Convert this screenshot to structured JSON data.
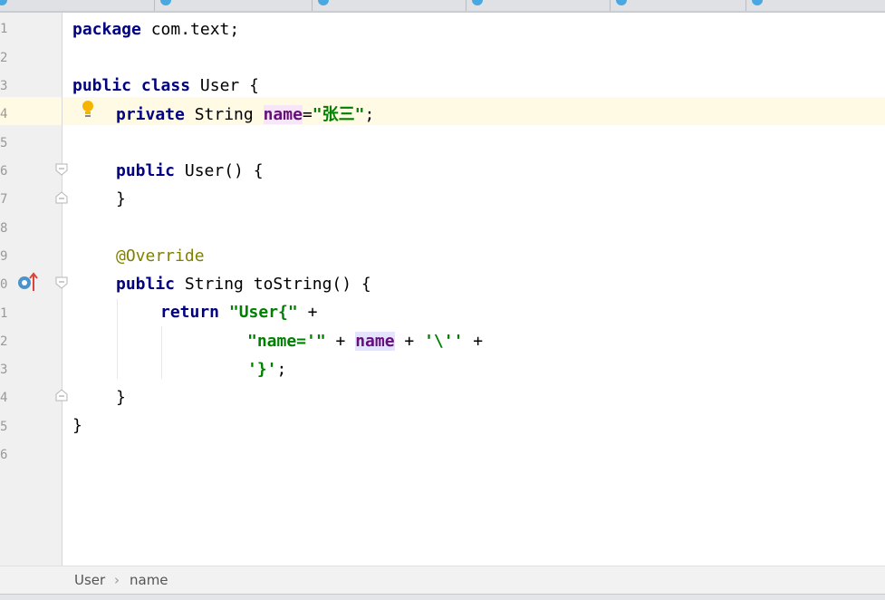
{
  "tabs": [
    {
      "label": ""
    },
    {
      "label": ""
    },
    {
      "label": ""
    },
    {
      "label": ""
    },
    {
      "label": ""
    },
    {
      "label": ""
    }
  ],
  "line_numbers": [
    "1",
    "2",
    "3",
    "4",
    "5",
    "6",
    "7",
    "8",
    "9",
    "0",
    "1",
    "2",
    "3",
    "4",
    "5",
    "6"
  ],
  "code": {
    "l1_kw": "package",
    "l1_rest": " com.text;",
    "l3_kw1": "public",
    "l3_kw2": "class",
    "l3_rest": " User {",
    "l4_kw": "private",
    "l4_type": " String ",
    "l4_field": "name",
    "l4_eq": "=",
    "l4_str": "\"张三\"",
    "l4_end": ";",
    "l6_kw": "public",
    "l6_rest": " User() {",
    "l7": "}",
    "l9_ann": "@Override",
    "l10_kw": "public",
    "l10_rest": " String toString() {",
    "l11_kw": "return",
    "l11_str": "\"User{\"",
    "l11_rest": " +",
    "l12_str1": "\"name='\"",
    "l12_plus1": " + ",
    "l12_field": "name",
    "l12_plus2": " + ",
    "l12_str2": "'\\''",
    "l12_plus3": " +",
    "l13_str": "'}'",
    "l13_end": ";",
    "l14": "}",
    "l15": "}"
  },
  "breadcrumb": {
    "class_name": "User",
    "separator": "›",
    "member": "name"
  },
  "colors": {
    "keyword": "#000080",
    "string": "#008000",
    "field": "#660e7a",
    "annotation": "#808000",
    "caret_row": "#fffae3"
  }
}
